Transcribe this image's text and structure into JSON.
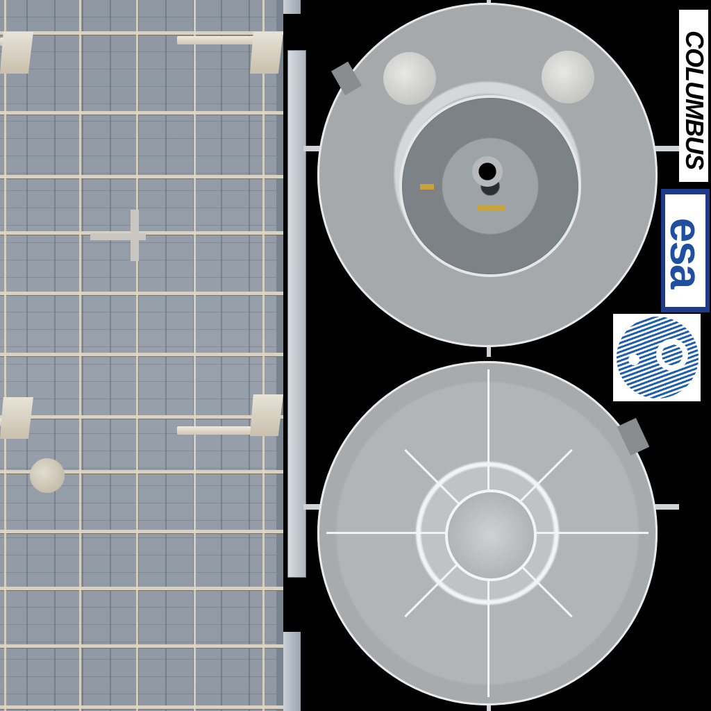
{
  "texture": {
    "module_name": "COLUMBUS",
    "agency_wordmark": "esa"
  },
  "colors": {
    "background": "#000000",
    "hull_panel": "#98a1ab",
    "rail": "#d9d1c2",
    "cone_grey": "#a6a9ac",
    "esa_blue": "#1e4fa1",
    "logo_background": "#ffffff"
  },
  "icons": [
    "columbus-logo",
    "esa-wordmark-logo",
    "esa-emblem-logo"
  ]
}
